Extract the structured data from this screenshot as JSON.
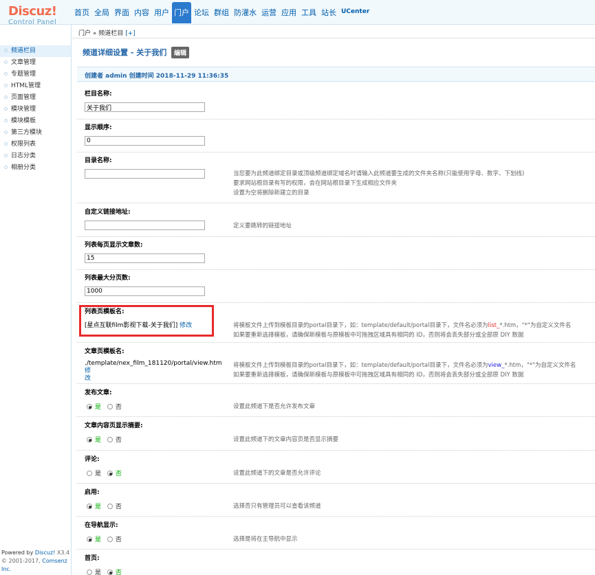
{
  "logo": {
    "brand": "Discuz!",
    "sub": "Control Panel"
  },
  "nav": [
    "首页",
    "全局",
    "界面",
    "内容",
    "用户",
    "门户",
    "论坛",
    "群组",
    "防灌水",
    "运营",
    "应用",
    "工具",
    "站长",
    "UCenter"
  ],
  "sidebar": [
    "频道栏目",
    "文章管理",
    "专题管理",
    "HTML管理",
    "页面管理",
    "模块管理",
    "模块模板",
    "第三方模块",
    "权限列表",
    "日志分类",
    "相册分类"
  ],
  "footer": {
    "powered": "Powered by",
    "brand": "Discuz!",
    "version": "X3.4",
    "copy": "© 2001-2017,",
    "company": "Comsenz Inc."
  },
  "crumb": {
    "text": "门户 » 频道栏目",
    "plus": "[+]"
  },
  "title": "频道详细设置 - 关于我们",
  "edit": "编辑",
  "meta": "创建者 admin 创建时间 2018-11-29 11:36:35",
  "fields": {
    "name": {
      "label": "栏目名称:",
      "value": "关于我们"
    },
    "order": {
      "label": "显示顺序:",
      "value": "0"
    },
    "dir": {
      "label": "目录名称:",
      "value": "",
      "tip1": "当您要为此频道绑定目录或顶级频道绑定域名时请输入此频道要生成的文件夹名称(只能使用字母、数字、下划线)",
      "tip2": "要求网站根目录有写的权限，会在网站根目录下生成相应文件夹",
      "tip3": "设置为空将删除新建立的目录"
    },
    "url": {
      "label": "自定义链接地址:",
      "value": "",
      "tip": "定义要跳转的链接地址"
    },
    "perpage": {
      "label": "列表每页显示文章数:",
      "value": "15"
    },
    "maxpage": {
      "label": "列表最大分页数:",
      "value": "1000"
    },
    "listtpl": {
      "label": "列表页模板名:",
      "value": "[星点互联film影视下载-关于我们]",
      "modify": "修改",
      "tip1a": "将模板文件上传到模板目录的portal目录下，如：template/default/portal目录下，文件名必须为",
      "tip1b": "list_",
      "tip1c": "*.htm，\"*\"为自定义文件名",
      "tip2": "如果要重新选择模板，请确保新模板与原模板中可拖拽区域具有相同的 ID，否则将会丢失部分或全部原 DIY 数据"
    },
    "viewtpl": {
      "label": "文章页模板名:",
      "value": "./template/nex_film_181120/portal/view.htm",
      "modify": "修",
      "modify2": "改",
      "tip1a": "将模板文件上传到模板目录的portal目录下，如：template/default/portal目录下，文件名必须为",
      "tip1b": "view_",
      "tip1c": "*.htm，\"*\"为自定义文件名",
      "tip2": "如果要重新选择模板，请确保新模板与原模板中可拖拽区域具有相同的 ID，否则将会丢失部分或全部原 DIY 数据"
    },
    "publish": {
      "label": "发布文章:",
      "yes": "是",
      "no": "否",
      "tip": "设置此频道下是否允许发布文章"
    },
    "summary": {
      "label": "文章内容页显示摘要:",
      "yes": "是",
      "no": "否",
      "tip": "设置此频道下的文章内容页是否显示摘要"
    },
    "comment": {
      "label": "评论:",
      "yes": "是",
      "no": "否",
      "tip": "设置此频道下的文章是否允许评论"
    },
    "enable": {
      "label": "启用:",
      "yes": "是",
      "no": "否",
      "tip": "选择否只有管理员可以查看该频道"
    },
    "shownav": {
      "label": "在导航显示:",
      "yes": "是",
      "no": "否",
      "tip": "选择是将在主导航中显示"
    },
    "home": {
      "label": "首页:",
      "yes": "是",
      "no": "否"
    }
  }
}
